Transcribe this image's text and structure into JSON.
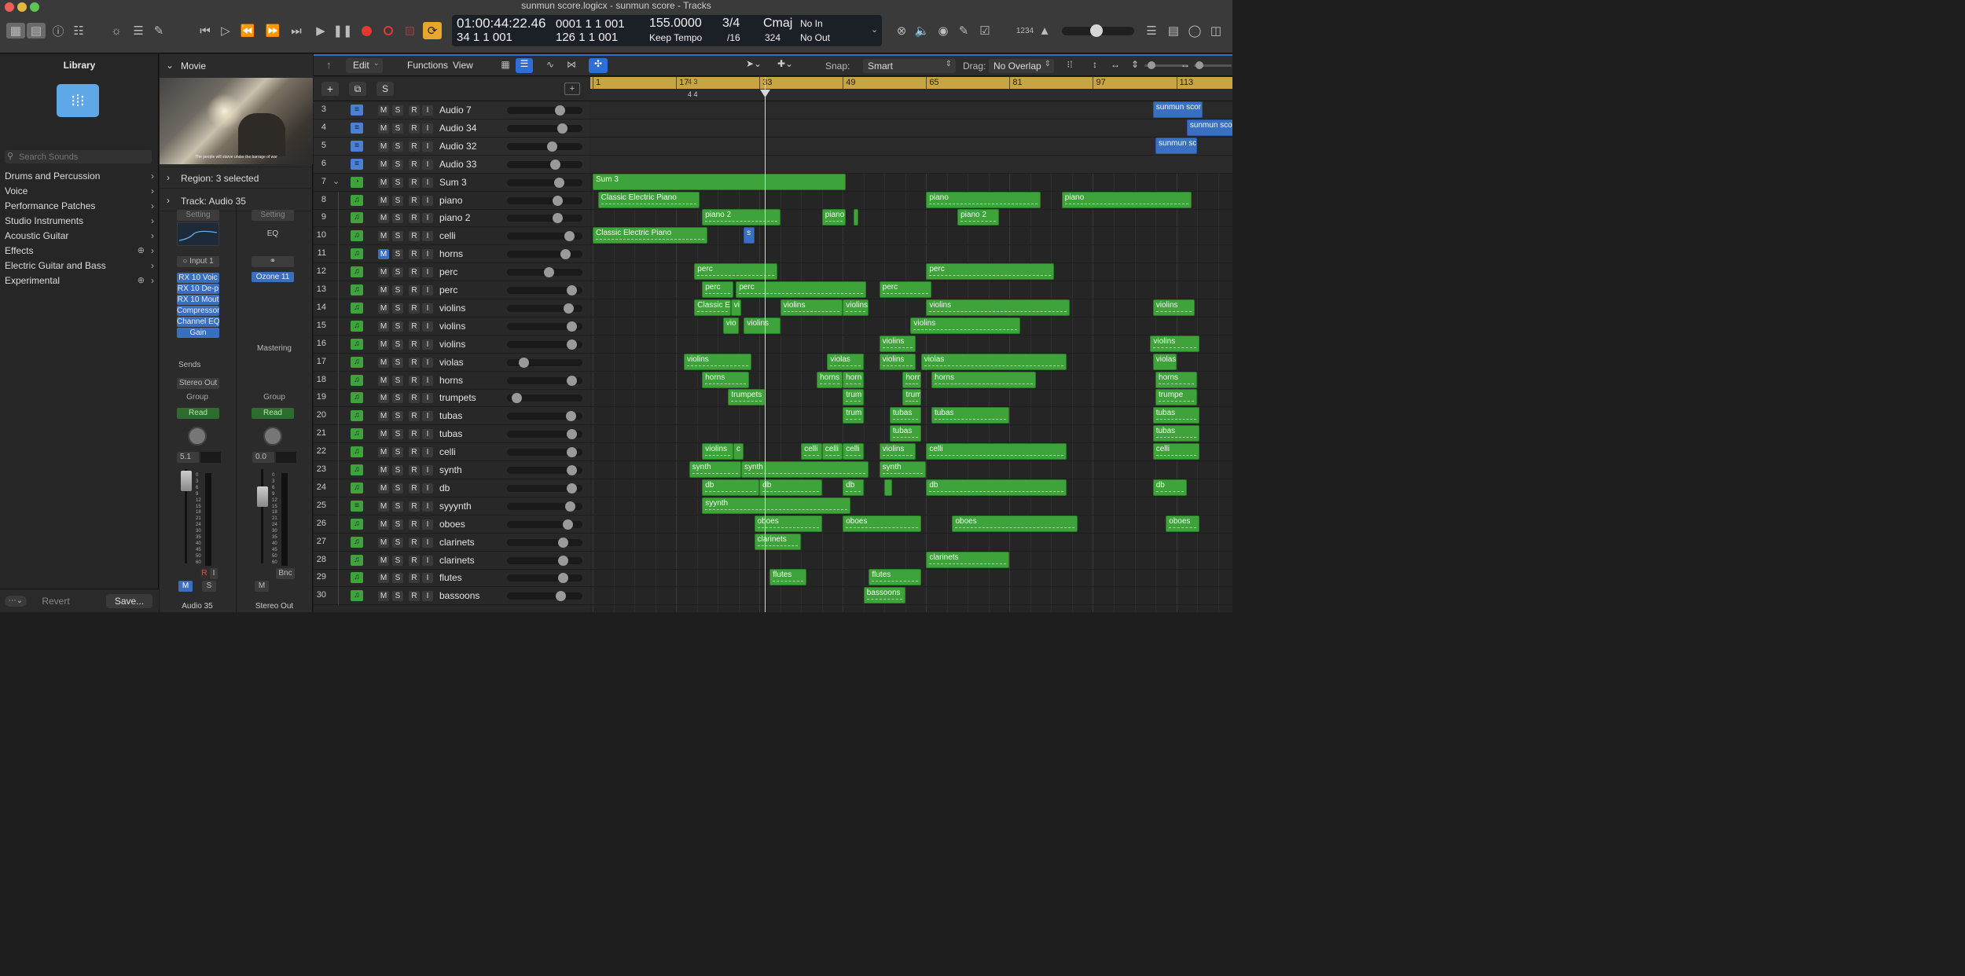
{
  "window_title": "sunmun score.logicx - sunmun score - Tracks",
  "lcd": {
    "time": "01:00:44:22.46",
    "time_sub": "0001  1  1  001",
    "position": "34  1  1  001",
    "position_sub": "126  1  1  001",
    "tempo": "155.0000",
    "tempo_mode": "Keep Tempo",
    "signature": "3/4",
    "division": "/16",
    "key": "Cmaj",
    "key_sub": "324",
    "in_label": "No In",
    "out_label": "No Out"
  },
  "toolbar_right": {
    "count_in": "1234"
  },
  "library": {
    "title": "Library",
    "search_placeholder": "Search Sounds",
    "items": [
      "Drums and Percussion",
      "Voice",
      "Performance Patches",
      "Studio Instruments",
      "Acoustic Guitar",
      "Effects",
      "Electric Guitar and Bass",
      "Experimental"
    ],
    "revert": "Revert",
    "save": "Save..."
  },
  "inspector": {
    "movie_label": "Movie",
    "movie_caption": "The people will starve under the barrage of war",
    "region_label": "Region: 3 selected",
    "track_label": "Track: Audio 35",
    "input": "Input 1",
    "plugins": [
      "RX 10 Voic",
      "RX 10 De-p",
      "RX 10 Mout",
      "Compressor",
      "Channel EQ",
      "Gain"
    ],
    "eq_label": "EQ",
    "ozone": "Ozone 11",
    "mastering": "Mastering",
    "setting": "Setting",
    "sends": "Sends",
    "stereo_out": "Stereo Out",
    "group": "Group",
    "read": "Read",
    "pan_left": "5.1",
    "pan_right": "0.0",
    "bnc": "Bnc",
    "m": "M",
    "s": "S",
    "r": "R",
    "i": "I",
    "ch1_name": "Audio 35",
    "ch2_name": "Stereo Out",
    "meter_scale": [
      "0",
      "3",
      "6",
      "9",
      "12",
      "15",
      "18",
      "21",
      "24",
      "30",
      "35",
      "40",
      "45",
      "50",
      "60"
    ]
  },
  "tracks_toolbar": {
    "edit": "Edit",
    "functions": "Functions",
    "view": "View",
    "snap_label": "Snap:",
    "snap_value": "Smart",
    "drag_label": "Drag:",
    "drag_value": "No Overlap",
    "s_button": "S"
  },
  "ruler": {
    "bars": [
      "1",
      "17",
      "33",
      "49",
      "65",
      "81",
      "97",
      "113"
    ],
    "sig_change": "4 3",
    "sig_change_lower": "4 4"
  },
  "track_buttons": {
    "m": "M",
    "s": "S",
    "r": "R",
    "i": "I"
  },
  "tracks": [
    {
      "num": "3",
      "name": "Audio 7",
      "type": "audio",
      "vol": 0.74
    },
    {
      "num": "4",
      "name": "Audio 34",
      "type": "audio",
      "vol": 0.77
    },
    {
      "num": "5",
      "name": "Audio 32",
      "type": "audio",
      "vol": 0.62
    },
    {
      "num": "6",
      "name": "Audio 33",
      "type": "audio",
      "vol": 0.66
    },
    {
      "num": "7",
      "name": "Sum 3",
      "type": "summing",
      "vol": 0.72
    },
    {
      "num": "8",
      "name": "piano",
      "type": "midi",
      "vol": 0.7
    },
    {
      "num": "9",
      "name": "piano 2",
      "type": "midi",
      "vol": 0.7
    },
    {
      "num": "10",
      "name": "celli",
      "type": "midi",
      "vol": 0.88
    },
    {
      "num": "11",
      "name": "horns",
      "type": "midi",
      "vol": 0.82,
      "muted": true
    },
    {
      "num": "12",
      "name": "perc",
      "type": "midi",
      "vol": 0.57
    },
    {
      "num": "13",
      "name": "perc",
      "type": "midi",
      "vol": 0.92
    },
    {
      "num": "14",
      "name": "violins",
      "type": "midi",
      "vol": 0.87
    },
    {
      "num": "15",
      "name": "violins",
      "type": "midi",
      "vol": 0.92
    },
    {
      "num": "16",
      "name": "violins",
      "type": "midi",
      "vol": 0.92
    },
    {
      "num": "17",
      "name": "violas",
      "type": "midi",
      "vol": 0.18
    },
    {
      "num": "18",
      "name": "horns",
      "type": "midi",
      "vol": 0.92
    },
    {
      "num": "19",
      "name": "trumpets",
      "type": "midi",
      "vol": 0.07
    },
    {
      "num": "20",
      "name": "tubas",
      "type": "midi",
      "vol": 0.9
    },
    {
      "num": "21",
      "name": "tubas",
      "type": "midi",
      "vol": 0.92
    },
    {
      "num": "22",
      "name": "celli",
      "type": "midi",
      "vol": 0.92
    },
    {
      "num": "23",
      "name": "synth",
      "type": "midi",
      "vol": 0.92
    },
    {
      "num": "24",
      "name": "db",
      "type": "midi",
      "vol": 0.92
    },
    {
      "num": "25",
      "name": "syyynth",
      "type": "instrument",
      "vol": 0.89
    },
    {
      "num": "26",
      "name": "oboes",
      "type": "midi",
      "vol": 0.85
    },
    {
      "num": "27",
      "name": "clarinets",
      "type": "midi",
      "vol": 0.78
    },
    {
      "num": "28",
      "name": "clarinets",
      "type": "midi",
      "vol": 0.78
    },
    {
      "num": "29",
      "name": "flutes",
      "type": "midi",
      "vol": 0.78
    },
    {
      "num": "30",
      "name": "bassoons",
      "type": "midi",
      "vol": 0.75
    }
  ],
  "regions": [
    [
      {
        "b": 108.5,
        "e": 118,
        "label": "sunmun scor",
        "blue": true
      }
    ],
    [
      {
        "b": 115,
        "e": 125,
        "label": "sunmun score",
        "blue": true
      }
    ],
    [
      {
        "b": 109,
        "e": 117,
        "label": "sunmun sco",
        "blue": true
      }
    ],
    [],
    [
      {
        "b": 1,
        "e": 49.5,
        "label": "Sum 3"
      }
    ],
    [
      {
        "b": 2,
        "e": 21.5,
        "label": "Classic Electric Piano",
        "midi": true
      },
      {
        "b": 65,
        "e": 87,
        "label": "piano",
        "midi": true
      },
      {
        "b": 91,
        "e": 116,
        "label": "piano",
        "midi": true
      }
    ],
    [
      {
        "b": 22,
        "e": 37,
        "label": "piano 2",
        "midi": true
      },
      {
        "b": 45,
        "e": 49.5,
        "label": "piano",
        "midi": true
      },
      {
        "b": 51,
        "e": 52
      },
      {
        "b": 71,
        "e": 79,
        "label": "piano 2",
        "midi": true
      }
    ],
    [
      {
        "b": 1,
        "e": 23,
        "label": "Classic Electric Piano",
        "midi": true
      },
      {
        "b": 30,
        "e": 32,
        "label": "s",
        "blue": true
      }
    ],
    [],
    [
      {
        "b": 20.5,
        "e": 36.5,
        "label": "perc",
        "midi": true
      },
      {
        "b": 65,
        "e": 89.5,
        "label": "perc",
        "midi": true
      }
    ],
    [
      {
        "b": 22,
        "e": 28,
        "label": "perc",
        "midi": true
      },
      {
        "b": 28.5,
        "e": 53.5,
        "label": "perc",
        "midi": true
      },
      {
        "b": 56,
        "e": 66,
        "label": "perc",
        "midi": true
      }
    ],
    [
      {
        "b": 20.5,
        "e": 27.5,
        "label": "Classic El",
        "midi": true
      },
      {
        "b": 27.5,
        "e": 29.5,
        "label": "vi"
      },
      {
        "b": 37,
        "e": 49,
        "label": "violins",
        "midi": true
      },
      {
        "b": 49,
        "e": 54,
        "label": "violins",
        "midi": true
      },
      {
        "b": 65,
        "e": 92.5,
        "label": "violins",
        "midi": true
      },
      {
        "b": 108.5,
        "e": 116.5,
        "label": "violins",
        "midi": true
      }
    ],
    [
      {
        "b": 26,
        "e": 29,
        "label": "vio"
      },
      {
        "b": 30,
        "e": 37,
        "label": "violins"
      },
      {
        "b": 62,
        "e": 83,
        "label": "violins",
        "midi": true
      }
    ],
    [
      {
        "b": 56,
        "e": 63,
        "label": "violins",
        "midi": true
      },
      {
        "b": 108,
        "e": 117.5,
        "label": "violins",
        "midi": true
      }
    ],
    [
      {
        "b": 18.5,
        "e": 31.5,
        "label": "violins",
        "midi": true
      },
      {
        "b": 46,
        "e": 53,
        "label": "violas",
        "midi": true
      },
      {
        "b": 56,
        "e": 63,
        "label": "violins",
        "midi": true
      },
      {
        "b": 64,
        "e": 92,
        "label": "violas",
        "midi": true
      },
      {
        "b": 108.5,
        "e": 113,
        "label": "violas"
      }
    ],
    [
      {
        "b": 22,
        "e": 31,
        "label": "horns",
        "midi": true
      },
      {
        "b": 44,
        "e": 49,
        "label": "horns",
        "midi": true
      },
      {
        "b": 49,
        "e": 53,
        "label": "horn",
        "midi": true
      },
      {
        "b": 60.5,
        "e": 64,
        "label": "horn",
        "midi": true
      },
      {
        "b": 66,
        "e": 86,
        "label": "horns",
        "midi": true
      },
      {
        "b": 109,
        "e": 117,
        "label": "horns",
        "midi": true
      }
    ],
    [
      {
        "b": 27,
        "e": 34,
        "label": "trumpets",
        "midi": true
      },
      {
        "b": 49,
        "e": 53,
        "label": "trum",
        "midi": true
      },
      {
        "b": 60.5,
        "e": 64,
        "label": "trum",
        "midi": true
      },
      {
        "b": 109,
        "e": 117,
        "label": "trumpe",
        "midi": true
      }
    ],
    [
      {
        "b": 49,
        "e": 53,
        "label": "trum",
        "midi": true
      },
      {
        "b": 58,
        "e": 64,
        "label": "tubas",
        "midi": true
      },
      {
        "b": 66,
        "e": 81,
        "label": "tubas",
        "midi": true
      },
      {
        "b": 108.5,
        "e": 117.5,
        "label": "tubas",
        "midi": true
      }
    ],
    [
      {
        "b": 58,
        "e": 64,
        "label": "tubas",
        "midi": true
      },
      {
        "b": 108.5,
        "e": 117.5,
        "label": "tubas",
        "midi": true
      }
    ],
    [
      {
        "b": 22,
        "e": 28,
        "label": "violins",
        "midi": true
      },
      {
        "b": 28,
        "e": 30,
        "label": "c"
      },
      {
        "b": 41,
        "e": 45,
        "label": "celli",
        "midi": true
      },
      {
        "b": 45,
        "e": 49,
        "label": "celli",
        "midi": true
      },
      {
        "b": 49,
        "e": 53,
        "label": "celli",
        "midi": true
      },
      {
        "b": 56,
        "e": 63,
        "label": "violins",
        "midi": true
      },
      {
        "b": 65,
        "e": 92,
        "label": "celli",
        "midi": true
      },
      {
        "b": 108.5,
        "e": 117.5,
        "label": "celli",
        "midi": true
      }
    ],
    [
      {
        "b": 19.5,
        "e": 29.5,
        "label": "synth",
        "midi": true
      },
      {
        "b": 29.5,
        "e": 54,
        "label": "synth",
        "midi": true
      },
      {
        "b": 56,
        "e": 65,
        "label": "synth",
        "midi": true
      }
    ],
    [
      {
        "b": 22,
        "e": 33,
        "label": "db",
        "midi": true
      },
      {
        "b": 33,
        "e": 45,
        "label": "db",
        "midi": true
      },
      {
        "b": 49,
        "e": 53,
        "label": "db",
        "midi": true
      },
      {
        "b": 57,
        "e": 58.5
      },
      {
        "b": 65,
        "e": 92,
        "label": "db",
        "midi": true
      },
      {
        "b": 108.5,
        "e": 115,
        "label": "db",
        "midi": true
      }
    ],
    [
      {
        "b": 22,
        "e": 50.5,
        "label": "syynth",
        "midi": true
      }
    ],
    [
      {
        "b": 32,
        "e": 45,
        "label": "oboes",
        "midi": true
      },
      {
        "b": 49,
        "e": 64,
        "label": "oboes",
        "midi": true
      },
      {
        "b": 70,
        "e": 94,
        "label": "oboes",
        "midi": true
      },
      {
        "b": 111,
        "e": 117.5,
        "label": "oboes",
        "midi": true
      }
    ],
    [
      {
        "b": 32,
        "e": 41,
        "label": "clarinets",
        "midi": true
      }
    ],
    [
      {
        "b": 65,
        "e": 81,
        "label": "clarinets",
        "midi": true
      }
    ],
    [
      {
        "b": 35,
        "e": 42,
        "label": "flutes",
        "midi": true
      },
      {
        "b": 54,
        "e": 64,
        "label": "flutes",
        "midi": true
      }
    ],
    [
      {
        "b": 53,
        "e": 61,
        "label": "bassoons",
        "midi": true
      }
    ]
  ],
  "colors": {
    "accent": "#2d6fd6",
    "region_green": "#3ea33a",
    "region_blue": "#3b6fc1",
    "ruler": "#c8a445",
    "record": "#e03a2f",
    "cycle": "#e6a72a"
  }
}
